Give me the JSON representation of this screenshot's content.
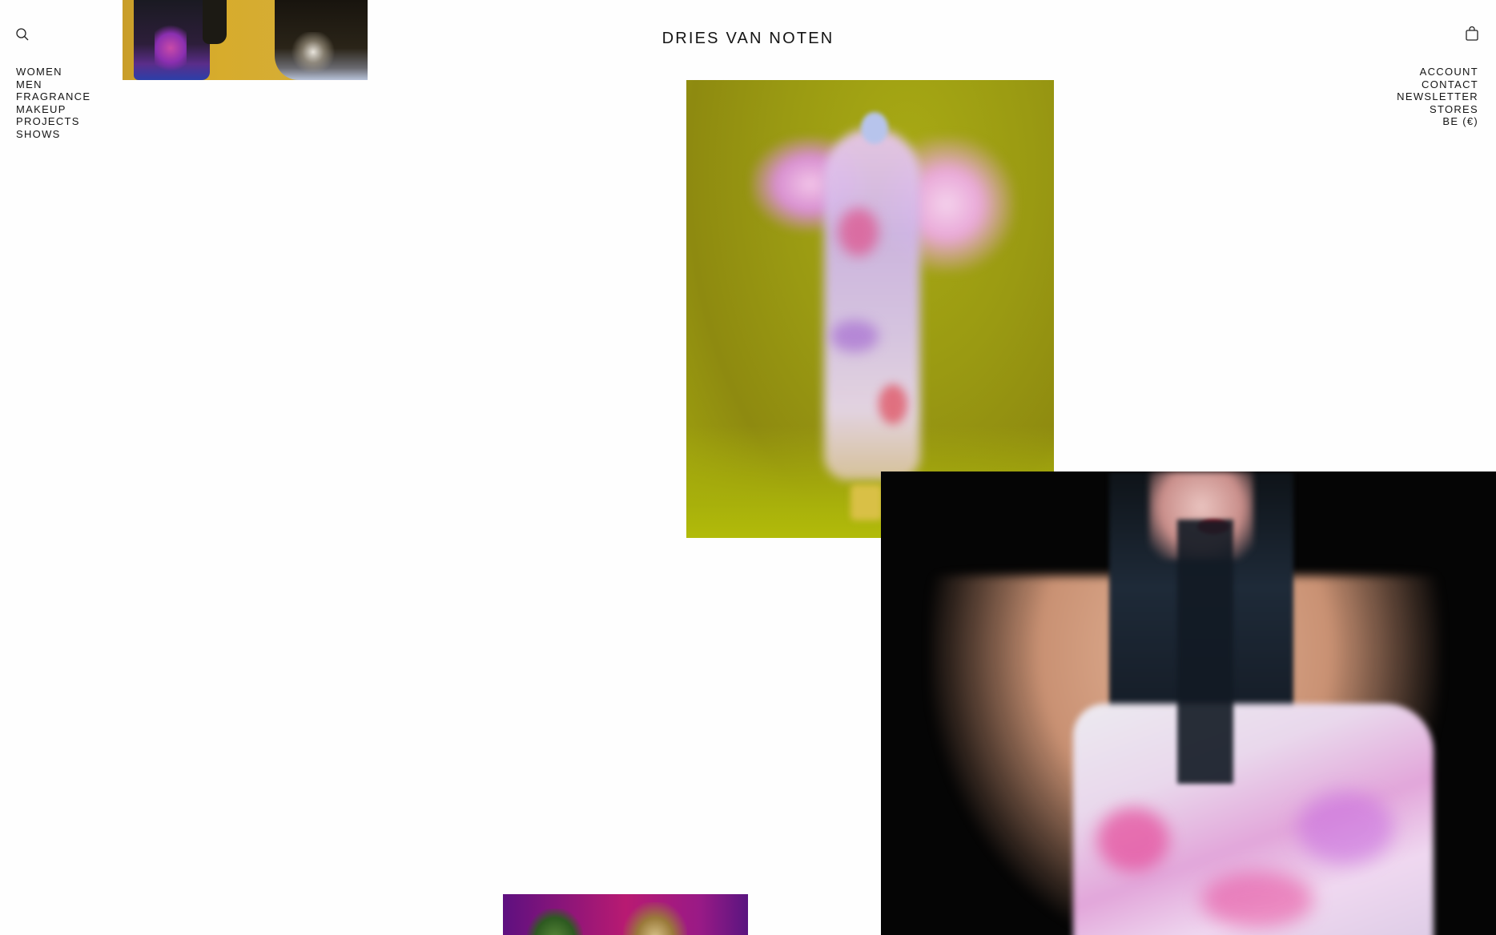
{
  "brand": {
    "logo_text": "DRIES VAN NOTEN"
  },
  "icons": {
    "search": "search-icon",
    "bag": "shopping-bag-icon"
  },
  "nav_left": {
    "items": [
      {
        "label": "WOMEN"
      },
      {
        "label": "MEN"
      },
      {
        "label": "FRAGRANCE"
      },
      {
        "label": "MAKEUP"
      },
      {
        "label": "PROJECTS"
      },
      {
        "label": "SHOWS"
      }
    ]
  },
  "nav_right": {
    "items": [
      {
        "label": "ACCOUNT"
      },
      {
        "label": "CONTACT"
      },
      {
        "label": "NEWSLETTER"
      },
      {
        "label": "STORES"
      },
      {
        "label": "BE (€)"
      }
    ]
  },
  "colors": {
    "text": "#141414",
    "background": "#fefefe"
  }
}
